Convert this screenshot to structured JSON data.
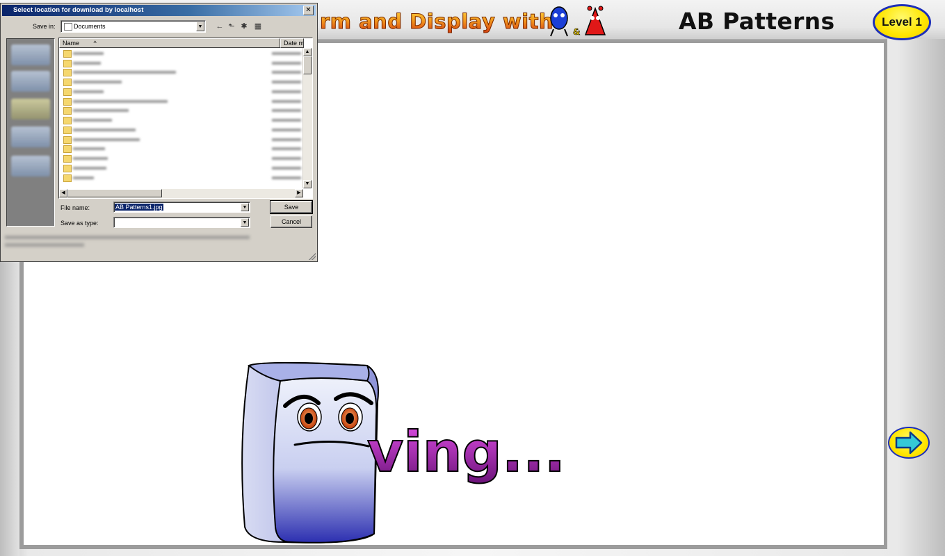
{
  "app": {
    "title": "rm and Display with",
    "page_heading": "AB Patterns",
    "level_label": "Level 1",
    "saving_text": "ving..."
  },
  "colors": {
    "dialog_title_bar": "#0a246a",
    "badge_yellow": "#ffe500",
    "badge_border": "#1d2fb8",
    "saving_text": "#8a1fa0"
  },
  "icons": {
    "next": "right-arrow-icon",
    "mascot_q": "blue-mascot-icon",
    "mascot_a": "red-mascot-icon",
    "saving_character": "floppy-disk-character"
  },
  "dialog": {
    "title": "Select location for download by localhost",
    "save_in_label": "Save in:",
    "save_in_value": "Documents",
    "columns": {
      "name": "Name",
      "date": "Date m"
    },
    "file_name_label": "File name:",
    "file_name_value": "AB Patterns1.jpg",
    "save_as_type_label": "Save as type:",
    "save_as_type_value": "",
    "save_button": "Save",
    "cancel_button": "Cancel",
    "toolbar_icons": [
      "back-arrow-icon",
      "up-folder-icon",
      "new-folder-icon",
      "view-menu-icon"
    ]
  }
}
